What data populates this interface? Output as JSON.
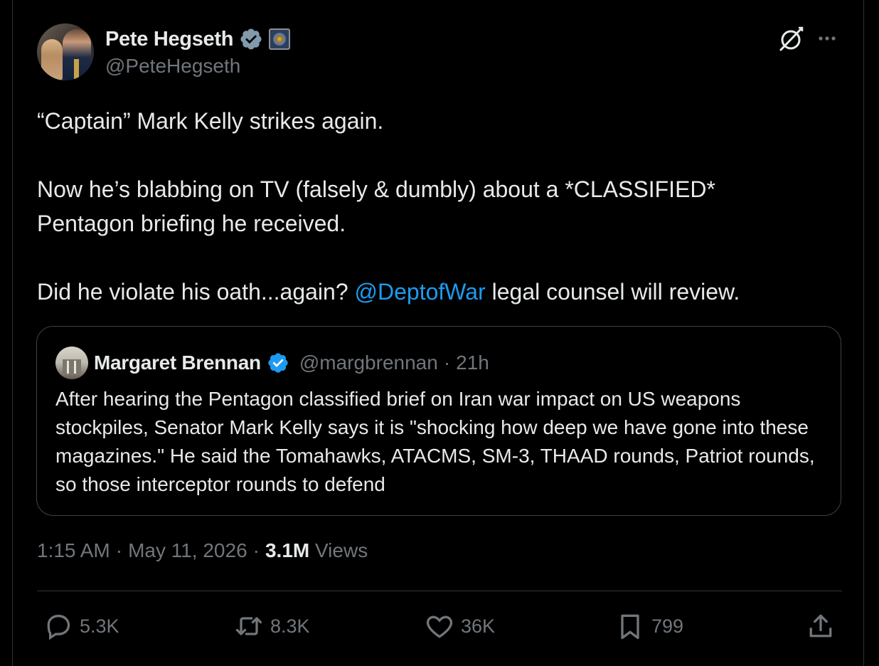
{
  "author": {
    "name": "Pete Hegseth",
    "handle": "@PeteHegseth",
    "verified": true,
    "affiliation_badge": "department-seal-icon"
  },
  "tweet": {
    "lines": [
      "“Captain” Mark Kelly strikes again.",
      "Now he’s blabbing on TV (falsely & dumbly) about a *CLASSIFIED* Pentagon briefing he received.",
      "Did he violate his oath...again?"
    ],
    "mention": "@DeptofWar",
    "line3_suffix": " legal counsel will review."
  },
  "quote": {
    "name": "Margaret Brennan",
    "handle": "@margbrennan",
    "separator": "·",
    "time": "21h",
    "text": "After hearing the Pentagon classified brief on Iran war impact on US weapons stockpiles, Senator Mark Kelly says it is \"shocking how deep we have gone into these magazines.\" He said the Tomahawks, ATACMS, SM-3, THAAD rounds, Patriot rounds, so those interceptor rounds to defend"
  },
  "meta": {
    "time": "1:15 AM",
    "sep1": "·",
    "date": "May 11, 2026",
    "sep2": "·",
    "views_count": "3.1M",
    "views_label": "Views"
  },
  "actions": {
    "replies": "5.3K",
    "reposts": "8.3K",
    "likes": "36K",
    "bookmarks": "799"
  },
  "colors": {
    "background": "#000000",
    "text": "#e7e9ea",
    "secondary": "#71767b",
    "accent": "#1d9bf0",
    "border": "#2f3336"
  }
}
